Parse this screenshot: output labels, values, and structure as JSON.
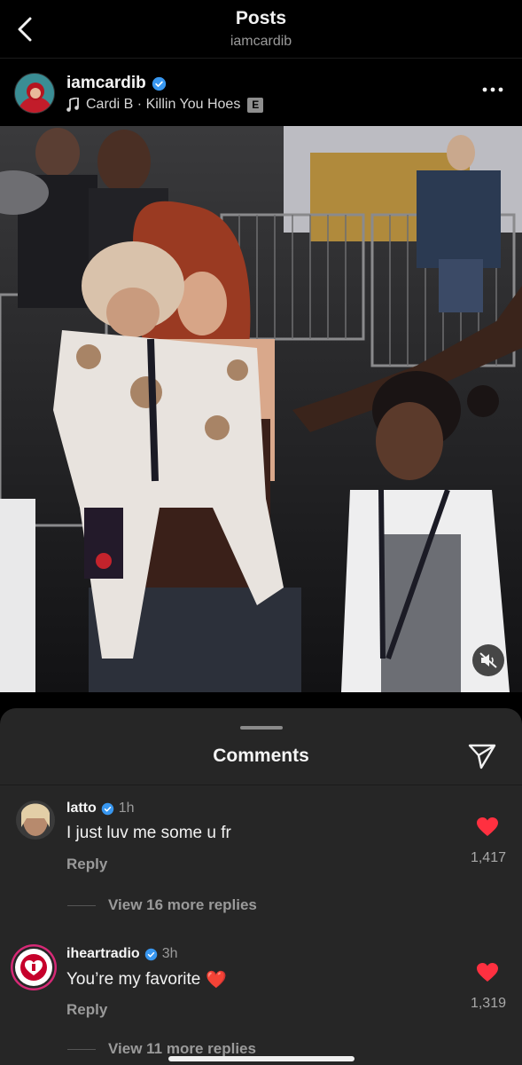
{
  "topbar": {
    "title": "Posts",
    "subtitle": "iamcardib"
  },
  "post": {
    "username": "iamcardib",
    "song": "Cardi B · Killin You Hoes",
    "explicit_badge": "E"
  },
  "comments_sheet": {
    "title": "Comments",
    "comments": [
      {
        "username": "latto",
        "time": "1h",
        "text": "I just luv me some u fr",
        "emoji": "",
        "reply_label": "Reply",
        "likes": "1,417",
        "view_more": "View 16 more replies"
      },
      {
        "username": "iheartradio",
        "time": "3h",
        "text": "You’re my favorite",
        "emoji": "❤️",
        "reply_label": "Reply",
        "likes": "1,319",
        "view_more": "View 11 more replies"
      }
    ]
  },
  "colors": {
    "background": "#000000",
    "sheet": "#262626",
    "verified": "#3897f0",
    "like_red": "#ff3040"
  }
}
